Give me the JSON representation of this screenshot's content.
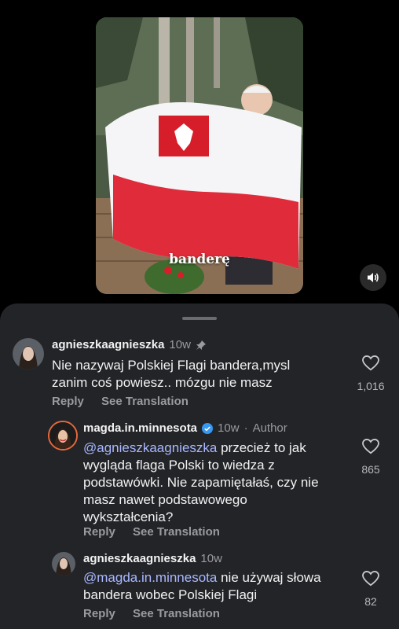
{
  "video": {
    "caption": "banderę"
  },
  "comments": [
    {
      "username": "agnieszkaagnieszka",
      "time": "10w",
      "text": "Nie nazywaj Polskiej Flagi bandera,mysl zanim coś powiesz.. mózgu nie masz",
      "reply_label": "Reply",
      "translation_label": "See Translation",
      "likes": "1,016"
    },
    {
      "username": "magda.in.minnesota",
      "time": "10w",
      "separator": "·",
      "author_label": "Author",
      "mention": "@agnieszkaagnieszka",
      "text": " przecież to jak wygląda flaga Polski to wiedza z podstawówki. Nie zapamiętałaś, czy nie masz nawet podstawowego wykształcenia?",
      "reply_label": "Reply",
      "translation_label": "See Translation",
      "likes": "865"
    },
    {
      "username": "agnieszkaagnieszka",
      "time": "10w",
      "mention": "@magda.in.minnesota",
      "text": " nie używaj słowa bandera wobec Polskiej Flagi",
      "reply_label": "Reply",
      "translation_label": "See Translation",
      "likes": "82"
    }
  ]
}
